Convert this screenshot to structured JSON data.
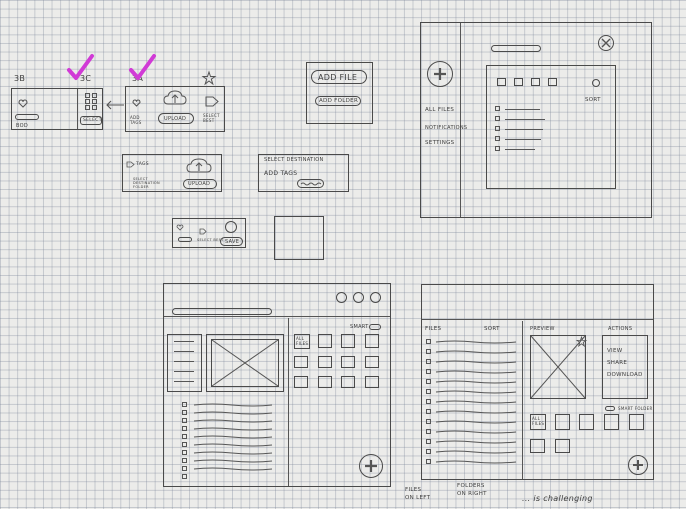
{
  "labels": {
    "s3b": "3B",
    "s3c": "3C",
    "s3a": "3A",
    "bod": "BOD",
    "select_small": "SELECT",
    "add_tags": "ADD TAGS",
    "upload": "UPLOAD",
    "select_best": "SELECT BEST",
    "add_file": "ADD FILE",
    "add_folder": "ADD FOLDER",
    "tags": "TAGS",
    "select_destination_folder": "SELECT DESTINATION FOLDER",
    "select_destination": "SELECT DESTINATION",
    "add_tags_title": "ADD TAGS",
    "save": "SAVE",
    "select_best_2": "SELECT BEST",
    "all_files": "ALL FILES",
    "notifications": "NOTIFICATIONS",
    "settings": "SETTINGS",
    "sort": "SORT",
    "smart": "SMART",
    "all_files_short": "ALL FILES",
    "files": "FILES",
    "preview": "PREVIEW",
    "actions": "ACTIONS",
    "view": "VIEW",
    "share": "SHARE",
    "download": "DOWNLOAD",
    "smart_folder": "SMART FOLDER",
    "note_files_left": "FILES ON LEFT",
    "note_folders_right": "FOLDERS ON RIGHT",
    "note_bottom": "... is challenging"
  },
  "icons": [
    "heart-icon",
    "grid-icon",
    "arrow-left-icon",
    "star-icon",
    "cloud-upload-icon",
    "tag-icon",
    "plus-icon",
    "close-icon",
    "folder-icon",
    "image-placeholder-icon",
    "toggle-icon",
    "checkmark-icon"
  ],
  "colors": {
    "ink": "#4a4a4a",
    "paper": "#ececea",
    "grid": "#8a93a6",
    "check": "#d13ad6"
  }
}
